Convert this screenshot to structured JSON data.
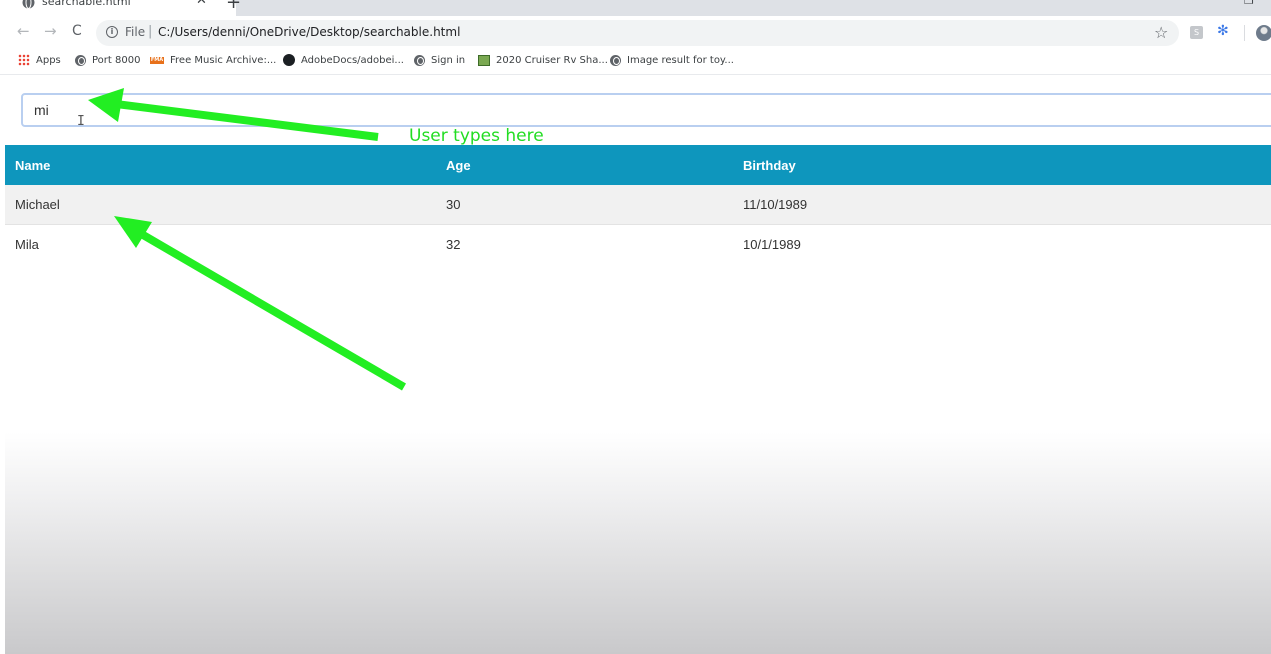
{
  "browser": {
    "tab_title": "searchable.html",
    "tab_close": "✕",
    "new_tab": "+",
    "restore": "❐",
    "back": "←",
    "forward": "→",
    "reload": "C",
    "scheme_label": "File",
    "separator": "|",
    "url": "C:/Users/denni/OneDrive/Desktop/searchable.html",
    "star": "☆",
    "ext_icon": "✻",
    "bookmarks": [
      {
        "label": "Apps",
        "icon": "apps-grid"
      },
      {
        "label": "Port 8000",
        "icon": "globe"
      },
      {
        "label": "Free Music Archive:...",
        "icon": "fma"
      },
      {
        "label": "AdobeDocs/adobei...",
        "icon": "github"
      },
      {
        "label": "Sign in",
        "icon": "globe"
      },
      {
        "label": "2020 Cruiser Rv Sha...",
        "icon": "rv"
      },
      {
        "label": "Image result for toy...",
        "icon": "globe"
      }
    ]
  },
  "search": {
    "value": "mi"
  },
  "table": {
    "headers": [
      "Name",
      "Age",
      "Birthday"
    ],
    "rows": [
      [
        "Michael",
        "30",
        "11/10/1989"
      ],
      [
        "Mila",
        "32",
        "10/1/1989"
      ]
    ]
  },
  "annotation": {
    "label": "User types here",
    "color": "#22dd22"
  },
  "colors": {
    "table_header": "#0e96bd",
    "row_alt": "#f1f1f1",
    "input_border": "#b9cff0"
  }
}
